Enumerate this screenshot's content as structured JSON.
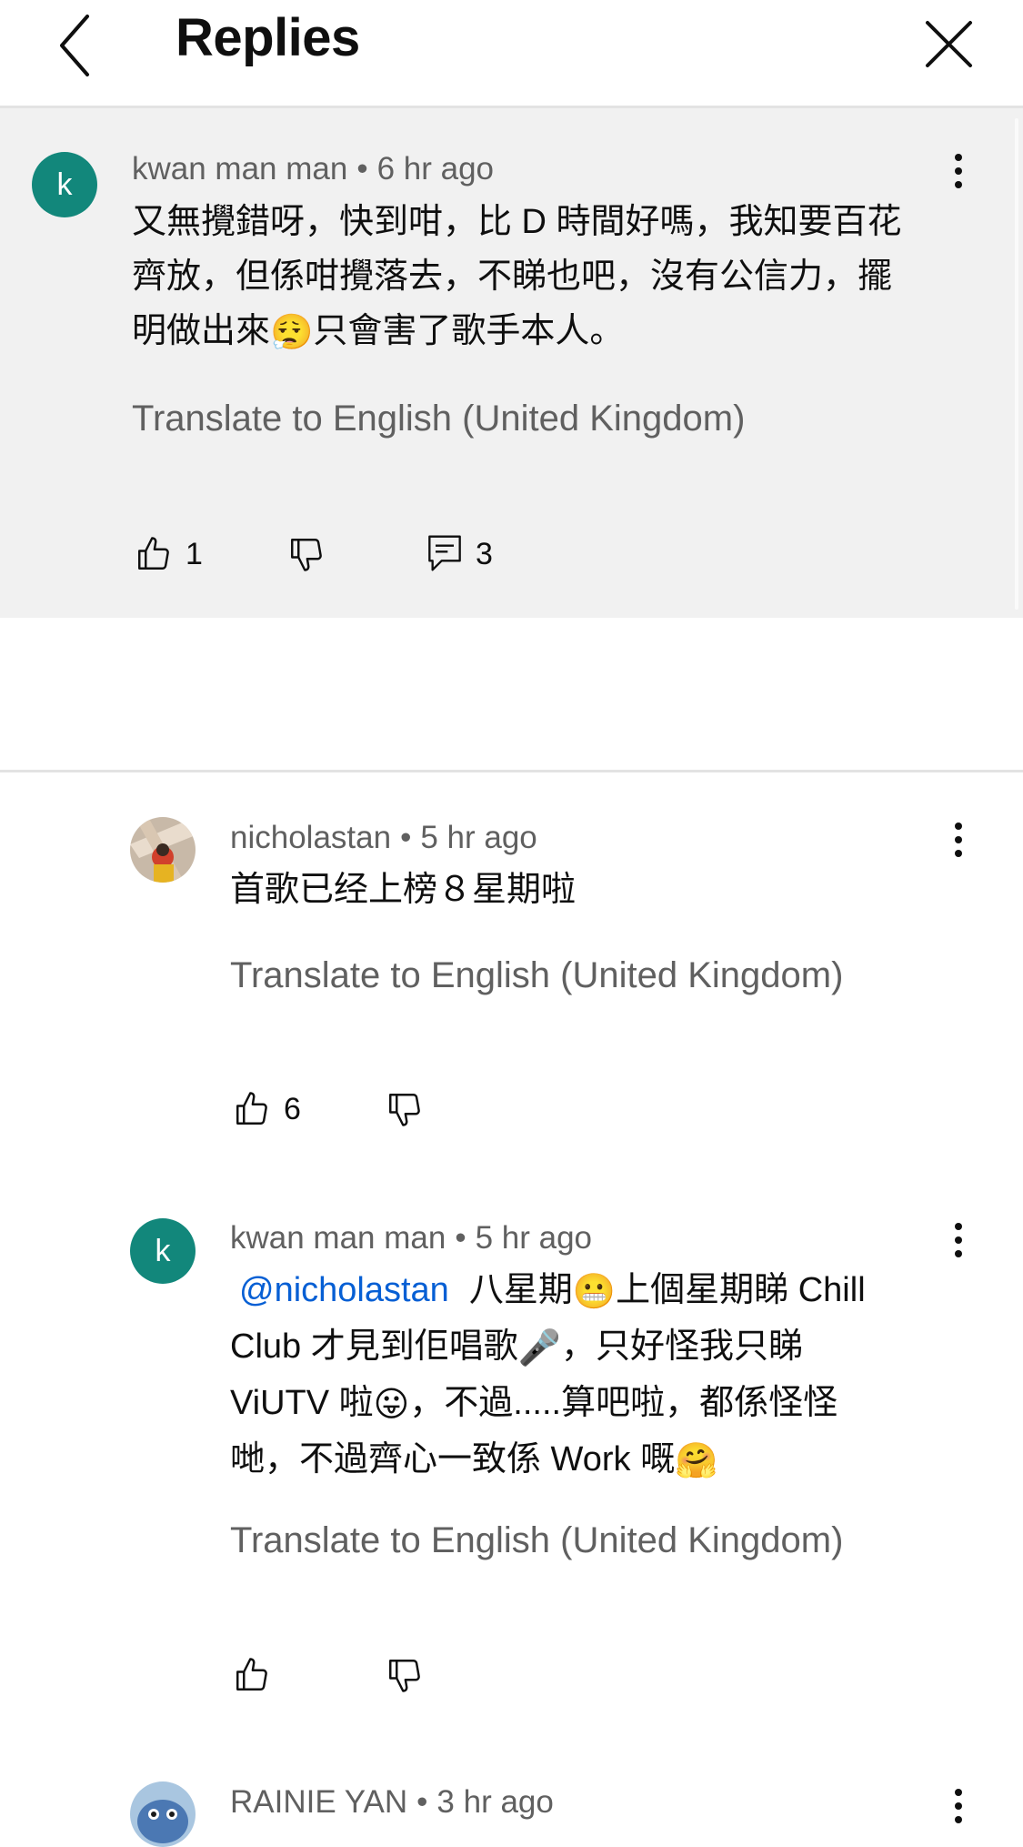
{
  "header": {
    "title": "Replies",
    "back_icon": "chevron-left-icon",
    "close_icon": "close-icon"
  },
  "parent_comment": {
    "avatar_letter": "k",
    "author": "kwan man man",
    "time": "6 hr ago",
    "text_line1": "又無攪錯呀，快到咁，比 D 時間好嗎，我知要百花",
    "text_line2": "齊放，但係咁攪落去，不睇也吧，沒有公信力，擺",
    "text_line3_a": "明做出來",
    "text_line3_emoji": "😮‍💨",
    "text_line3_b": "只會害了歌手本人。",
    "translate": "Translate to English (United Kingdom)",
    "likes": "1",
    "replies": "3"
  },
  "replies": [
    {
      "author": "nicholastan",
      "time": "5 hr ago",
      "text": "首歌已经上榜８星期啦",
      "translate": "Translate to English (United Kingdom)",
      "likes": "6"
    },
    {
      "avatar_letter": "k",
      "author": "kwan man man",
      "time": "5 hr ago",
      "mention": "@nicholastan",
      "line1_a": "八星期",
      "emoji_grimace": "😬",
      "line1_b": "上個星期睇 Chill",
      "line2_a": "Club 才見到佢唱歌",
      "emoji_mic": "🎤",
      "line2_b": "，只好怪我只睇",
      "line3_a": "ViUTV 啦",
      "emoji_tongue": "😛",
      "line3_b": "，不過.....算吧啦，都係怪怪",
      "line4_a": "哋，不過齊心一致係 Work 嘅",
      "emoji_hug": "🤗",
      "translate": "Translate to English (United Kingdom)"
    },
    {
      "author": "RAINIE YAN",
      "time": "3 hr ago"
    }
  ],
  "icons": {
    "like": "thumbs-up-icon",
    "dislike": "thumbs-down-icon",
    "reply": "comment-icon",
    "more": "more-vertical-icon"
  },
  "colors": {
    "avatar_teal": "#12877b",
    "mention_blue": "#065fd4",
    "highlight_bg": "#f1f1f1",
    "meta_gray": "#606060"
  }
}
